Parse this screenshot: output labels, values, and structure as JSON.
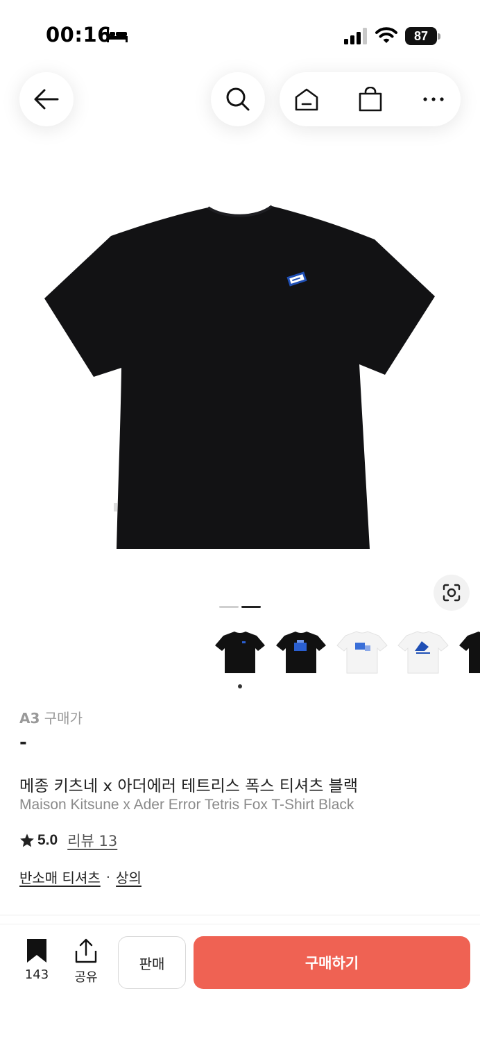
{
  "status_bar": {
    "time": "00:16",
    "battery": "87",
    "icons": [
      "bed-icon",
      "signal-icon",
      "wifi-icon",
      "battery-icon"
    ]
  },
  "nav": {
    "icons": [
      "back-arrow-icon",
      "search-icon",
      "home-icon",
      "shopping-bag-icon",
      "more-icon"
    ]
  },
  "gallery": {
    "main_image": "black t-shirt back view with small blue patch",
    "thumbnails": [
      "black-tshirt",
      "black-tshirt-print",
      "white-tshirt-print",
      "white-tshirt-fox",
      "black-tshirt-partial"
    ]
  },
  "product": {
    "price_size": "A3",
    "price_label": "구매가",
    "price_value": "-",
    "title_kr": "메종 키츠네 x 아더에러 테트리스 폭스 티셔츠 블랙",
    "title_en": "Maison Kitsune x Ader Error Tetris Fox T-Shirt Black",
    "rating": "5.0",
    "review_link": "리뷰 13",
    "category_1": "반소매 티셔츠",
    "category_sep": "·",
    "category_2": "상의"
  },
  "bottom_bar": {
    "bookmark_count": "143",
    "share_label": "공유",
    "sell_label": "판매",
    "buy_label": "구매하기"
  },
  "colors": {
    "accent": "#ef6253",
    "text": "#222222",
    "muted": "#999999"
  }
}
